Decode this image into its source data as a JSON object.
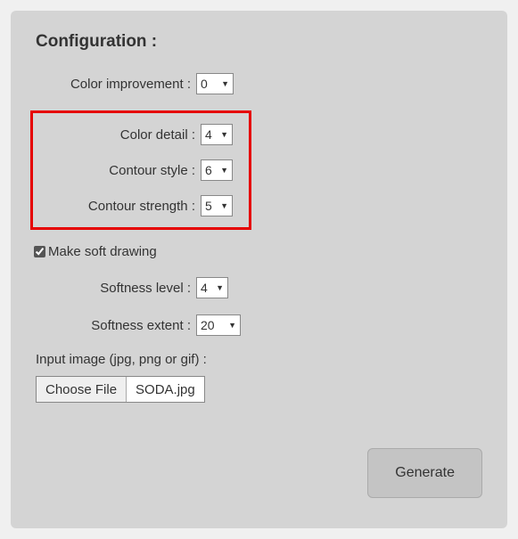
{
  "title": "Configuration :",
  "fields": {
    "color_improvement": {
      "label": "Color improvement :",
      "value": "0"
    },
    "color_detail": {
      "label": "Color detail :",
      "value": "4"
    },
    "contour_style": {
      "label": "Contour style :",
      "value": "6"
    },
    "contour_strength": {
      "label": "Contour strength :",
      "value": "5"
    },
    "softness_level": {
      "label": "Softness level :",
      "value": "4"
    },
    "softness_extent": {
      "label": "Softness extent :",
      "value": "20"
    }
  },
  "soft_drawing": {
    "label": "Make soft drawing",
    "checked": true
  },
  "input_image": {
    "label": "Input image (jpg, png or gif) :",
    "button": "Choose File",
    "filename": "SODA.jpg"
  },
  "generate_label": "Generate"
}
